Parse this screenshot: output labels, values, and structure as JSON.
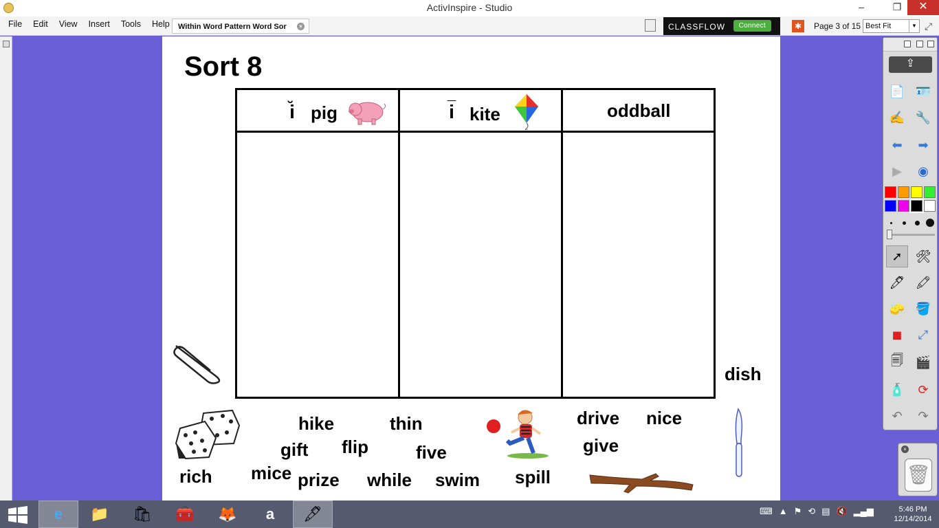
{
  "window": {
    "title": "ActivInspire - Studio",
    "minimize": "–",
    "restore": "❐",
    "close": "✕"
  },
  "menu": [
    "File",
    "Edit",
    "View",
    "Insert",
    "Tools",
    "Help"
  ],
  "document_tab": {
    "label": "Within Word Pattern Word Sor",
    "close": "×"
  },
  "classflow": {
    "brand": "CLASSFLOW",
    "connect": "Connect"
  },
  "pager": {
    "label": "Page 3 of 15",
    "zoom": "Best Fit"
  },
  "page": {
    "title": "Sort 8",
    "columns": [
      {
        "vowel": "i",
        "mark": "˘",
        "word": "pig",
        "picture": "pig"
      },
      {
        "vowel": "i",
        "mark": "¯",
        "word": "kite",
        "picture": "kite"
      },
      {
        "word": "oddball"
      }
    ],
    "words": {
      "dish": "dish",
      "hike": "hike",
      "thin": "thin",
      "drive": "drive",
      "nice": "nice",
      "gift": "gift",
      "flip": "flip",
      "five": "five",
      "give": "give",
      "rich": "rich",
      "mice": "mice",
      "prize": "prize",
      "while": "while",
      "swim": "swim",
      "spill": "spill"
    },
    "pictures": [
      "paperclip",
      "dice",
      "boy-kicking-ball",
      "knife",
      "stick"
    ]
  },
  "toolbox": {
    "colors": [
      "#ff0000",
      "#ff9900",
      "#ffff00",
      "#33ee33",
      "#0000ff",
      "#ee00ee",
      "#000000",
      "#ffffff"
    ],
    "tools": [
      "profile-icon",
      "page-browser-icon",
      "recognition-icon",
      "tools-icon",
      "previous-page-icon",
      "next-page-icon",
      "play-icon",
      "flipchart-icon",
      "select-icon",
      "tools-menu-icon",
      "pen-icon",
      "highlighter-icon",
      "eraser-icon",
      "fill-icon",
      "shape-icon",
      "connector-icon",
      "duplicate-icon",
      "camera-icon",
      "clear-icon",
      "reset-icon",
      "undo-icon",
      "redo-icon"
    ]
  },
  "taskbar": {
    "apps": [
      "internet-explorer",
      "file-explorer",
      "store",
      "app",
      "firefox",
      "amazon",
      "activinspire"
    ],
    "time": "5:46 PM",
    "date": "12/14/2014"
  }
}
